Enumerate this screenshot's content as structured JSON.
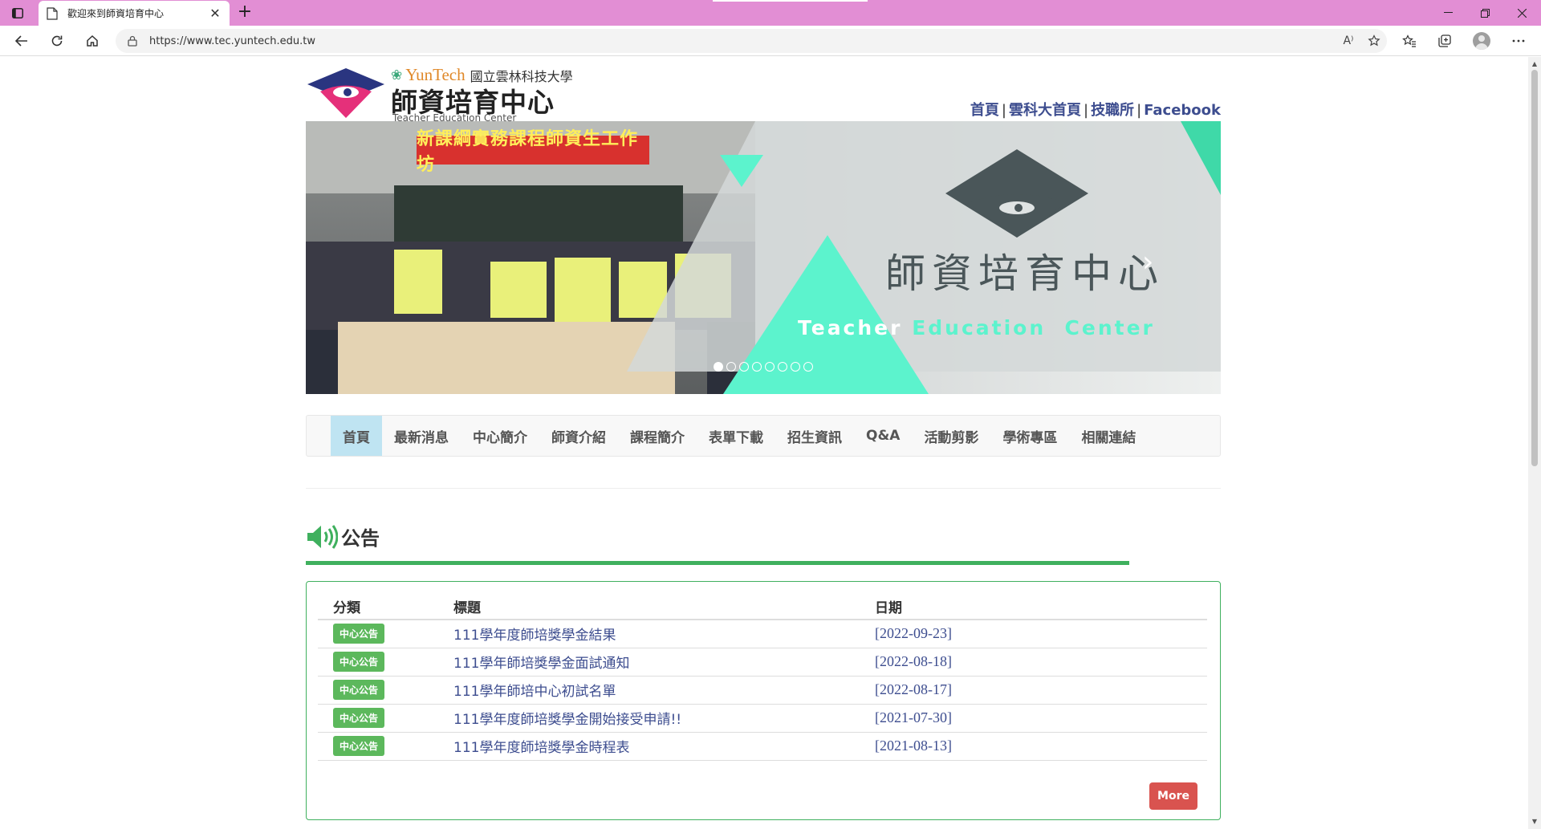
{
  "browser": {
    "tab_title": "歡迎來到師資培育中心",
    "url": "https://www.tec.yuntech.edu.tw",
    "read_aloud_icon": "A⁾"
  },
  "header": {
    "yuntech": "YunTech",
    "university": "國立雲林科技大學",
    "title": "師資培育中心",
    "subtitle": "Teacher Education Center",
    "links": [
      "首頁",
      "雲科大首頁",
      "技職所",
      "Facebook"
    ],
    "separator": "|"
  },
  "banner": {
    "photo_label": "新課綱實務課程師資生工作坊",
    "title": "師資培育中心",
    "en_word1": "Teacher",
    "en_word2": "Education  Center",
    "slide_count": 8,
    "active_slide": 1
  },
  "nav": {
    "items": [
      "首頁",
      "最新消息",
      "中心簡介",
      "師資介紹",
      "課程簡介",
      "表單下載",
      "招生資訊",
      "Q&A",
      "活動剪影",
      "學術專區",
      "相關連結"
    ],
    "active_index": 0
  },
  "announcements": {
    "heading": "公告",
    "columns": [
      "分類",
      "標題",
      "日期"
    ],
    "rows": [
      {
        "category": "中心公告",
        "title": "111學年度師培獎學金結果",
        "date": "[2022-09-23]"
      },
      {
        "category": "中心公告",
        "title": "111學年師培獎學金面試通知",
        "date": "[2022-08-18]"
      },
      {
        "category": "中心公告",
        "title": "111學年師培中心初試名單",
        "date": "[2022-08-17]"
      },
      {
        "category": "中心公告",
        "title": "111學年度師培獎學金開始接受申請!!",
        "date": "[2021-07-30]"
      },
      {
        "category": "中心公告",
        "title": "111學年度師培獎學金時程表",
        "date": "[2021-08-13]"
      }
    ],
    "more_label": "More"
  },
  "colors": {
    "titlebar": "#e28ed4",
    "accent_green": "#3fb05e",
    "link_blue": "#3d4d8f",
    "nav_active": "#bfe4f2",
    "more_red": "#d9534f",
    "teal": "#5cf3cd"
  }
}
